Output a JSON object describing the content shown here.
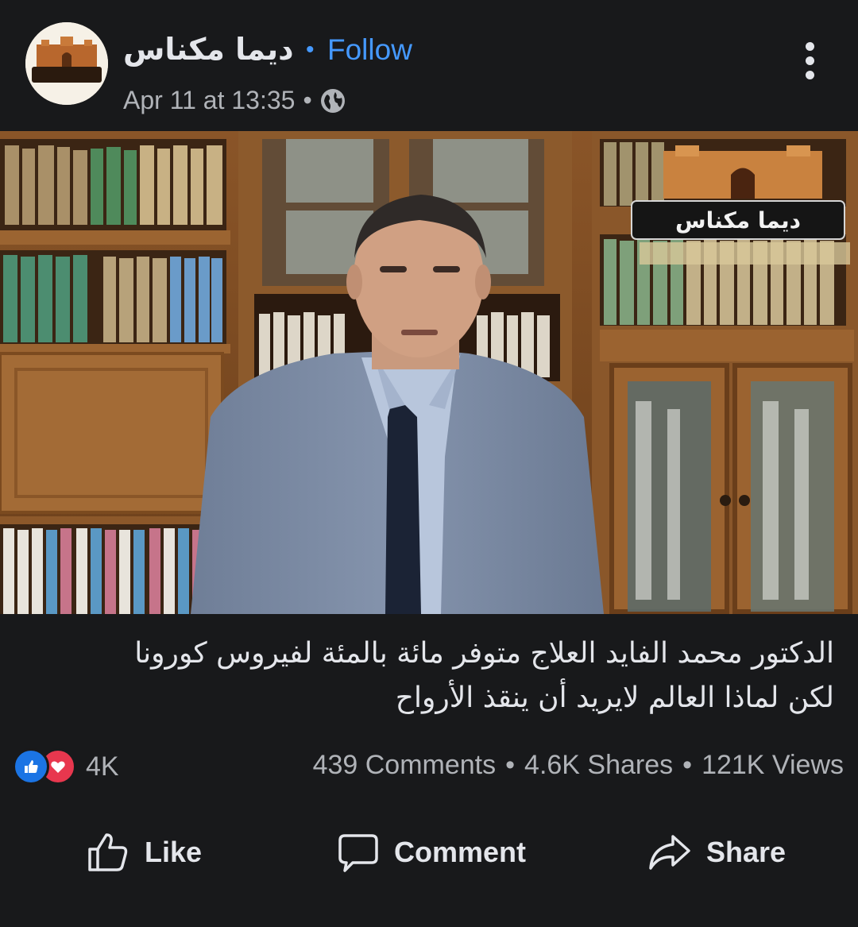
{
  "post": {
    "page_name": "ديما مكناس",
    "follow_dot": "•",
    "follow_label": "Follow",
    "timestamp": "Apr 11 at 13:35",
    "meta_dot": "•",
    "avatar_logo_text": "ديما مكناس",
    "privacy_icon": "globe-icon",
    "more_icon": "more-vertical-icon"
  },
  "video": {
    "watermark_text": "ديما مكناس"
  },
  "caption": {
    "line1": "الدكتور محمد الفايد العلاج متوفر مائة بالمئة لفيروس كورونا",
    "line2": "لكن لماذا العالم لايريد أن ينقذ الأرواح"
  },
  "engagement": {
    "reaction_count": "4K",
    "comments": "439 Comments",
    "shares": "4.6K Shares",
    "views": "121K Views",
    "separator": "•"
  },
  "actions": {
    "like": "Like",
    "comment": "Comment",
    "share": "Share"
  },
  "colors": {
    "background": "#18191b",
    "link_blue": "#4599ff",
    "like_blue": "#1b74e4",
    "love_red": "#e8374e"
  }
}
